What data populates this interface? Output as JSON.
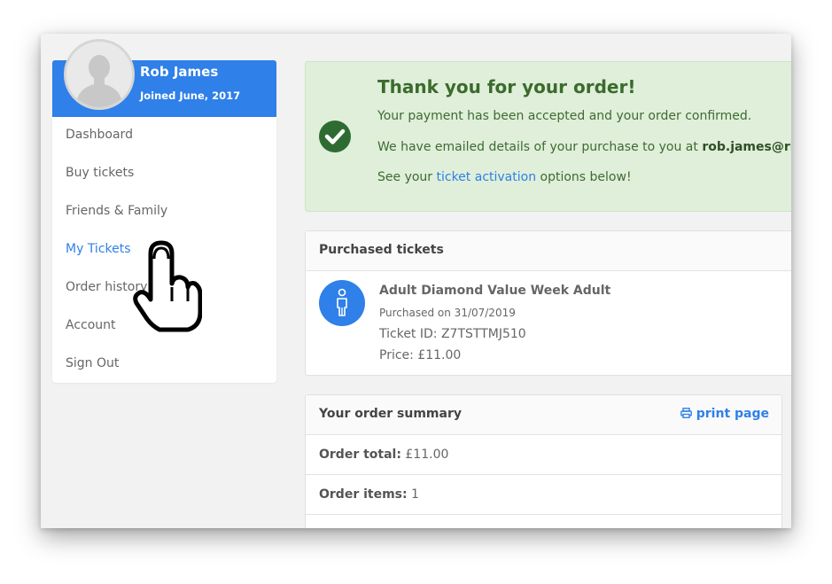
{
  "profile": {
    "name": "Rob James",
    "joined": "Joined June, 2017",
    "avatar_icon": "user-silhouette"
  },
  "sidebar": {
    "items": [
      {
        "label": "Dashboard"
      },
      {
        "label": "Buy tickets"
      },
      {
        "label": "Friends & Family"
      },
      {
        "label": "My Tickets",
        "active": true
      },
      {
        "label": "Order history"
      },
      {
        "label": "Account"
      },
      {
        "label": "Sign Out"
      }
    ]
  },
  "confirmation": {
    "icon": "check-circle-icon",
    "title": "Thank you for your order!",
    "line1": "Your payment has been accepted and your order confirmed.",
    "line2_prefix": "We have emailed details of your purchase to you at ",
    "line2_email": "rob.james@ris",
    "line3_prefix": "See your ",
    "line3_link": "ticket activation",
    "line3_suffix": " options below!"
  },
  "purchased": {
    "title": "Purchased tickets",
    "ticket": {
      "icon": "person-icon",
      "name": "Adult Diamond Value Week Adult",
      "purchased": "Purchased on 31/07/2019",
      "ticket_id": "Ticket ID: Z7TSTTMJ510",
      "price": "Price: £11.00"
    }
  },
  "summary": {
    "title": "Your order summary",
    "print_label": "print page",
    "order_total_label": "Order total:",
    "order_total_value": " £11.00",
    "order_items_label": "Order items:",
    "order_items_value": " 1"
  },
  "colors": {
    "accent": "#2f80e8",
    "success_bg": "#dfefd9",
    "success_text": "#3b6b2d"
  }
}
